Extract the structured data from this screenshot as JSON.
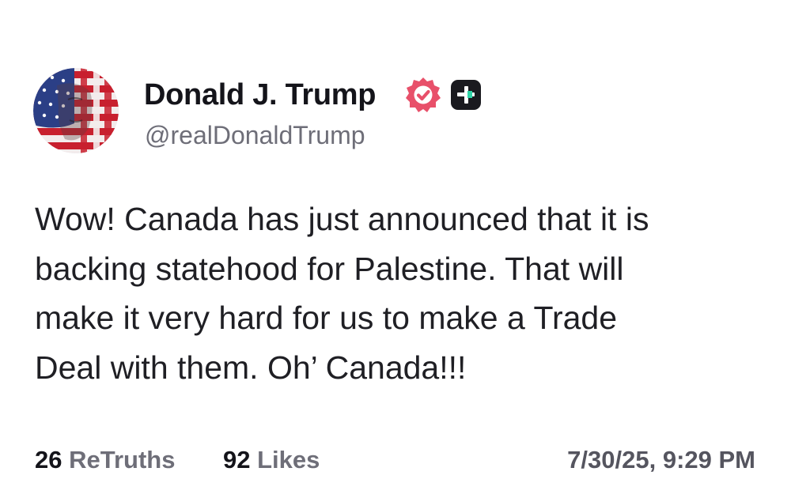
{
  "author": {
    "display_name": "Donald J. Trump",
    "handle": "@realDonaldTrump",
    "avatar_icon": "american-flag-portrait-avatar",
    "verified_icon": "verified-badge-icon",
    "verified_color": "#e8506a",
    "plus_icon": "plus-badge-icon"
  },
  "post": {
    "lines": [
      "Wow! Canada has just announced that it is",
      "backing statehood for Palestine. That will",
      "make it very hard for us to make a Trade",
      "Deal with them. Oh’ Canada!!!"
    ]
  },
  "stats": {
    "retruths_count": "26",
    "retruths_label": "ReTruths",
    "likes_count": "92",
    "likes_label": "Likes"
  },
  "timestamp": "7/30/25, 9:29 PM"
}
